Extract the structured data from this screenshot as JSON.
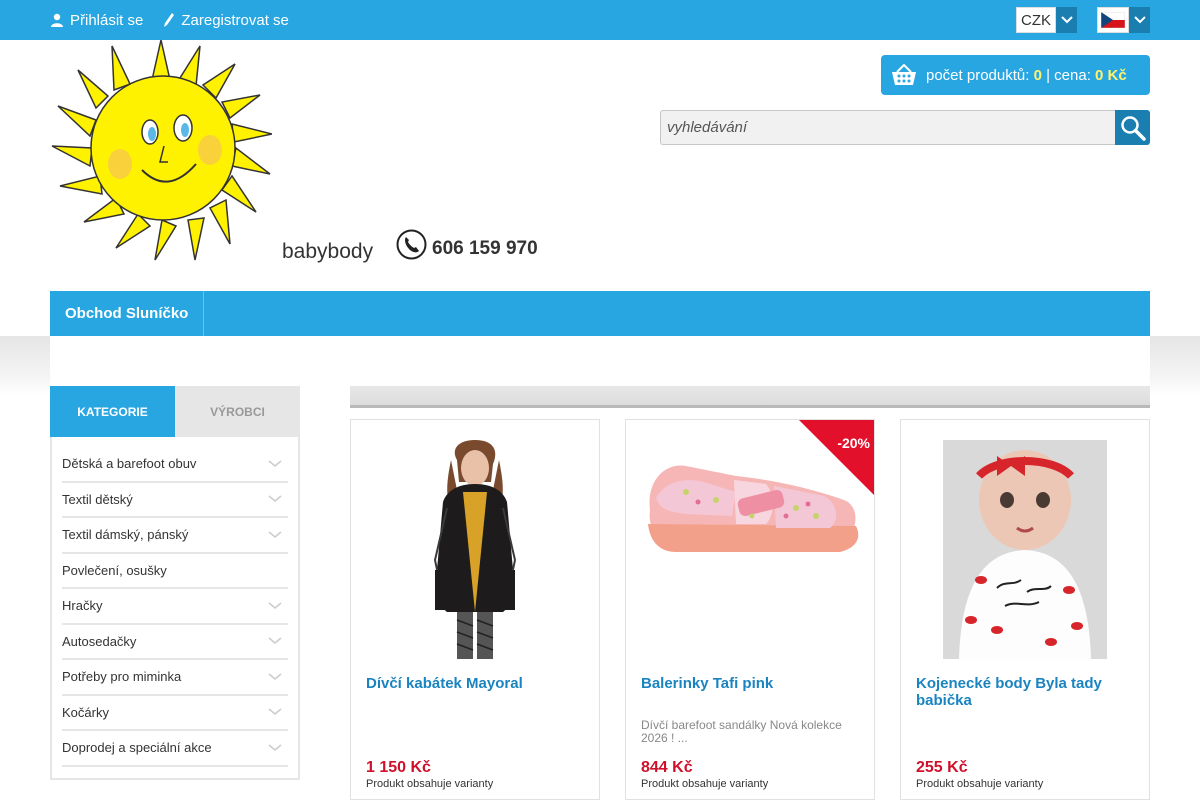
{
  "topbar": {
    "login_label": "Přihlásit se",
    "register_label": "Zaregistrovat se",
    "currency": "CZK",
    "language_flag": "flag-cz"
  },
  "header": {
    "brand": "babybody",
    "phone": "606 159 970",
    "cart": {
      "count_label": "počet produktů:",
      "count": "0",
      "separator": "|",
      "price_label": "cena:",
      "price": "0 Kč"
    },
    "search_placeholder": "vyhledávání"
  },
  "nav": {
    "items": [
      {
        "label": "Obchod Sluníčko"
      }
    ]
  },
  "sidebar": {
    "tabs": [
      {
        "label": "KATEGORIE",
        "active": true
      },
      {
        "label": "VÝROBCI",
        "active": false
      }
    ],
    "categories": [
      {
        "label": "Dětská a barefoot obuv",
        "has_children": true
      },
      {
        "label": "Textil dětský",
        "has_children": true
      },
      {
        "label": "Textil dámský, pánský",
        "has_children": true
      },
      {
        "label": "Povlečení, osušky",
        "has_children": false
      },
      {
        "label": "Hračky",
        "has_children": true
      },
      {
        "label": "Autosedačky",
        "has_children": true
      },
      {
        "label": "Potřeby pro miminka",
        "has_children": true
      },
      {
        "label": "Kočárky",
        "has_children": true
      },
      {
        "label": "Doprodej a speciální akce",
        "has_children": true
      }
    ]
  },
  "products": [
    {
      "title": "Dívčí kabátek Mayoral",
      "description": "",
      "price": "1 150 Kč",
      "variants": "Produkt obsahuje varianty",
      "badge": ""
    },
    {
      "title": "Balerinky Tafi pink",
      "description": "Dívčí barefoot sandálky Nová kolekce 2026 ! ...",
      "price": "844 Kč",
      "variants": "Produkt obsahuje varianty",
      "badge": "-20%"
    },
    {
      "title": "Kojenecké body Byla tady babička",
      "description": "",
      "price": "255 Kč",
      "variants": "Produkt obsahuje varianty",
      "badge": ""
    }
  ],
  "colors": {
    "accent": "#27a6e1",
    "accent_dark": "#1a7fb0",
    "price": "#d0102b",
    "badge": "#e3102b",
    "cart_highlight": "#fff36b"
  }
}
